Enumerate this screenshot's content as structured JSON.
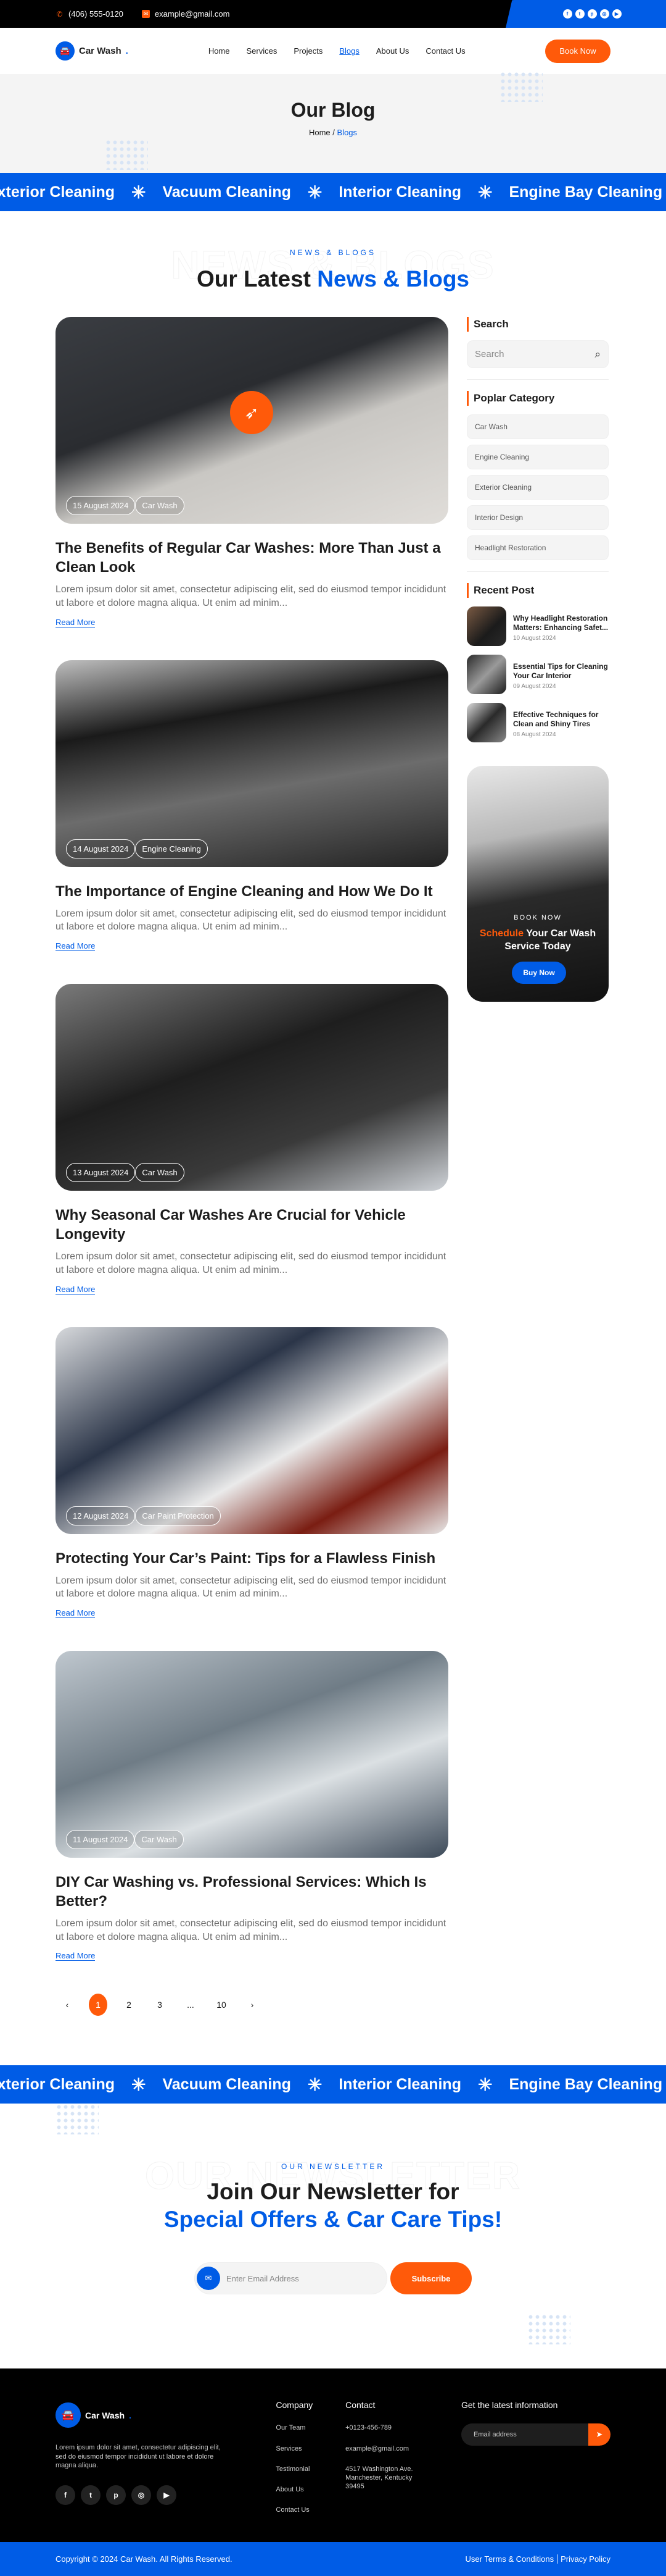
{
  "topbar": {
    "phone": "(406) 555-0120",
    "email": "example@gmail.com",
    "social": [
      "facebook-icon",
      "twitter-icon",
      "pinterest-icon",
      "instagram-icon",
      "youtube-icon"
    ]
  },
  "nav": {
    "brand": "Car Wash",
    "brand_dot": ".",
    "items": [
      "Home",
      "Services",
      "Projects",
      "Blogs",
      "About Us",
      "Contact Us"
    ],
    "active": "Blogs",
    "cta": "Book Now"
  },
  "hero": {
    "title": "Our Blog",
    "crumb_home": "Home",
    "crumb_sep": "/",
    "crumb_current": "Blogs"
  },
  "ticker": [
    "Exterior Cleaning",
    "Vacuum Cleaning",
    "Interior Cleaning",
    "Engine Bay Cleaning"
  ],
  "ticker_star": "✳",
  "blog_section": {
    "ghost": "NEWS & BLOGS",
    "eyebrow": "NEWS & BLOGS",
    "title_a": "Our Latest ",
    "title_b": "News & Blogs"
  },
  "posts": [
    {
      "date": "15 August 2024",
      "category": "Car Wash",
      "title": "The Benefits of Regular Car Washes: More Than Just a Clean Look",
      "excerpt": "Lorem ipsum dolor sit amet, consectetur adipiscing elit, sed do eiusmod tempor incididunt ut labore et dolore magna aliqua. Ut enim ad minim...",
      "link": "Read More"
    },
    {
      "date": "14 August 2024",
      "category": "Engine Cleaning",
      "title": "The Importance of Engine Cleaning and How We Do It",
      "excerpt": "Lorem ipsum dolor sit amet, consectetur adipiscing elit, sed do eiusmod tempor incididunt ut labore et dolore magna aliqua. Ut enim ad minim...",
      "link": "Read More"
    },
    {
      "date": "13 August 2024",
      "category": "Car Wash",
      "title": "Why Seasonal Car Washes Are Crucial for Vehicle Longevity",
      "excerpt": "Lorem ipsum dolor sit amet, consectetur adipiscing elit, sed do eiusmod tempor incididunt ut labore et dolore magna aliqua. Ut enim ad minim...",
      "link": "Read More"
    },
    {
      "date": "12 August 2024",
      "category": "Car Paint Protection",
      "title": "Protecting Your Car’s Paint: Tips for a Flawless Finish",
      "excerpt": "Lorem ipsum dolor sit amet, consectetur adipiscing elit, sed do eiusmod tempor incididunt ut labore et dolore magna aliqua. Ut enim ad minim...",
      "link": "Read More"
    },
    {
      "date": "11 August 2024",
      "category": "Car Wash",
      "title": "DIY Car Washing vs. Professional Services: Which Is Better?",
      "excerpt": "Lorem ipsum dolor sit amet, consectetur adipiscing elit, sed do eiusmod tempor incididunt ut labore et dolore magna aliqua. Ut enim ad minim...",
      "link": "Read More"
    }
  ],
  "pagination": {
    "prev": "‹",
    "pages": [
      "1",
      "2",
      "3",
      "...",
      "10"
    ],
    "current": "1",
    "next": "›"
  },
  "sidebar": {
    "search_title": "Search",
    "search_placeholder": "Search",
    "category_title": "Poplar Category",
    "categories": [
      "Car Wash",
      "Engine Cleaning",
      "Exterior Cleaning",
      "Interior Design",
      "Headlight Restoration"
    ],
    "recent_title": "Recent Post",
    "recent": [
      {
        "title": "Why Headlight Restoration Matters: Enhancing Safet...",
        "date": "10 August 2024"
      },
      {
        "title": "Essential Tips for Cleaning Your Car Interior",
        "date": "09 August 2024"
      },
      {
        "title": "Effective Techniques for Clean and Shiny Tires",
        "date": "08 August 2024"
      }
    ],
    "promo": {
      "eyebrow": "BOOK NOW",
      "title_hl": "Schedule",
      "title_rest": " Your Car Wash Service Today",
      "button": "Buy Now"
    }
  },
  "newsletter": {
    "ghost": "OUR NEWSLETTER",
    "eyebrow": "OUR NEWSLETTER",
    "title_a": "Join Our Newsletter for ",
    "title_b": "Special Offers & Car Care Tips!",
    "placeholder": "Enter Email Address",
    "button": "Subscribe"
  },
  "footer": {
    "brand": "Car Wash",
    "brand_dot": ".",
    "description": "Lorem ipsum dolor sit amet, consectetur adipiscing elit, sed do eiusmod tempor incididunt ut labore et dolore magna aliqua.",
    "company_title": "Company",
    "company_links": [
      "Our Team",
      "Services",
      "Testimonial",
      "About Us",
      "Contact Us"
    ],
    "contact_title": "Contact",
    "phone": "+0123-456-789",
    "email": "example@gmail.com",
    "address": "4517 Washington Ave. Manchester, Kentucky 39495",
    "info_title": "Get the latest information",
    "email_placeholder": "Email address"
  },
  "bottom": {
    "copyright": "Copyright © 2024 Car Wash. All Rights Reserved.",
    "terms": "User Terms & Conditions",
    "privacy": "Privacy Policy"
  },
  "colors": {
    "primary": "#005ce6",
    "accent": "#ff5a0a",
    "dark": "#000000"
  }
}
